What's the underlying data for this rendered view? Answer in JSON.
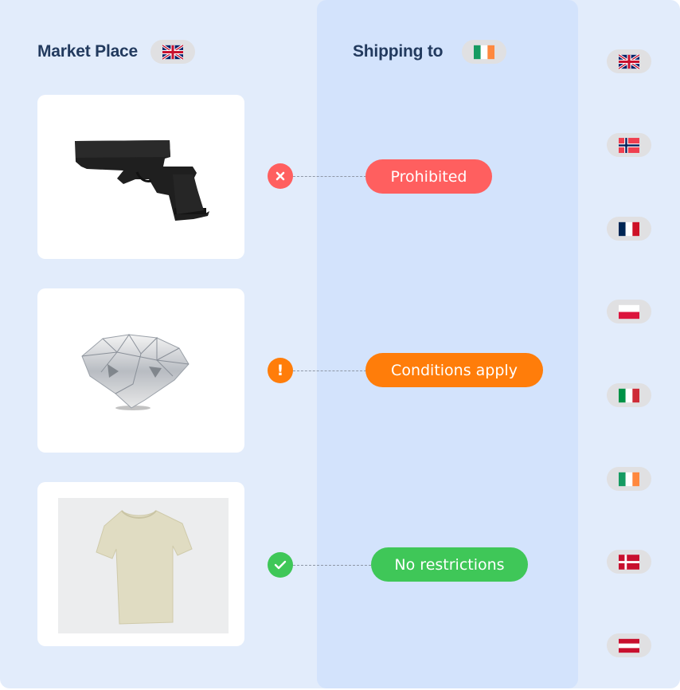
{
  "colors": {
    "panel_light": "#E2ECFB",
    "panel_mid": "#D3E3FC",
    "title_text": "#223A5E",
    "prohibited": "#FF5F5F",
    "conditions": "#FF7D0A",
    "no_restrictions": "#3FC758",
    "flag_pill": "#E0E0E2"
  },
  "marketplace": {
    "title": "Market Place",
    "flag": "uk-flag-icon"
  },
  "shipping": {
    "title": "Shipping to",
    "flag": "ireland-flag-icon"
  },
  "products": [
    {
      "name": "Handgun",
      "image": "handgun-image",
      "status_icon": "x-icon",
      "status": "Prohibited"
    },
    {
      "name": "Diamond",
      "image": "diamond-image",
      "status_icon": "exclamation-icon",
      "status": "Conditions apply"
    },
    {
      "name": "T-shirt",
      "image": "tshirt-image",
      "status_icon": "checkmark-icon",
      "status": "No restrictions"
    }
  ],
  "country_list": [
    {
      "country": "United Kingdom",
      "icon": "uk-flag-icon"
    },
    {
      "country": "Norway",
      "icon": "norway-flag-icon"
    },
    {
      "country": "France",
      "icon": "france-flag-icon"
    },
    {
      "country": "Poland",
      "icon": "poland-flag-icon"
    },
    {
      "country": "Italy",
      "icon": "italy-flag-icon"
    },
    {
      "country": "Ireland",
      "icon": "ireland-flag-icon"
    },
    {
      "country": "Denmark",
      "icon": "denmark-flag-icon"
    },
    {
      "country": "Austria",
      "icon": "austria-flag-icon"
    }
  ]
}
